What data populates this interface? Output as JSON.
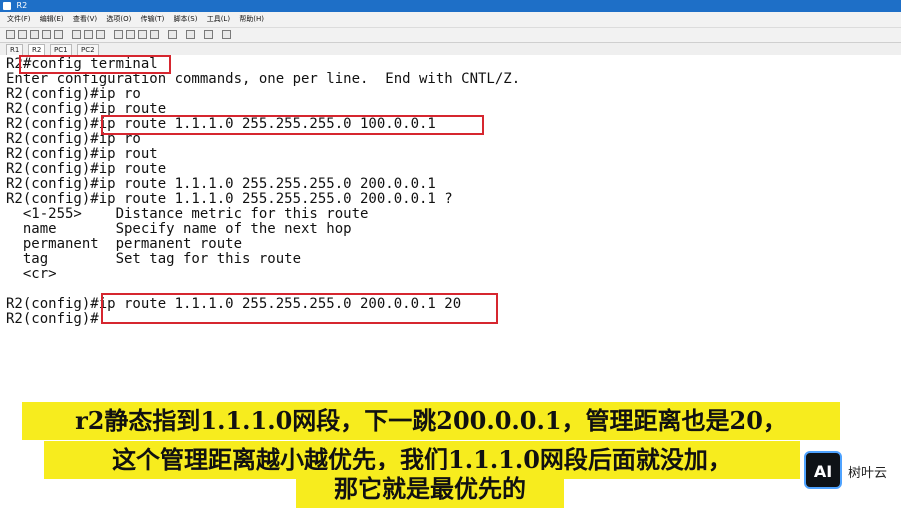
{
  "window": {
    "title": "R2"
  },
  "menu": [
    "文件(F)",
    "编辑(E)",
    "查看(V)",
    "选项(O)",
    "传输(T)",
    "脚本(S)",
    "工具(L)",
    "帮助(H)"
  ],
  "tabs": [
    "R1",
    "R2",
    "PC1",
    "PC2"
  ],
  "terminal": {
    "lines": [
      "R2#config terminal",
      "Enter configuration commands, one per line.  End with CNTL/Z.",
      "R2(config)#ip ro",
      "R2(config)#ip route",
      "R2(config)#ip route 1.1.1.0 255.255.255.0 100.0.0.1",
      "R2(config)#ip ro",
      "R2(config)#ip rout",
      "R2(config)#ip route",
      "R2(config)#ip route 1.1.1.0 255.255.255.0 200.0.0.1",
      "R2(config)#ip route 1.1.1.0 255.255.255.0 200.0.0.1 ?",
      "  <1-255>    Distance metric for this route",
      "  name       Specify name of the next hop",
      "  permanent  permanent route",
      "  tag        Set tag for this route",
      "  <cr>",
      "",
      "R2(config)#ip route 1.1.1.0 255.255.255.0 200.0.0.1 20",
      "R2(config)#"
    ]
  },
  "caption": {
    "line1": "r2静态指到1.1.1.0网段，下一跳200.0.0.1，管理距离也是20，",
    "line2": "这个管理距离越小越优先，我们1.1.1.0网段后面就没加，",
    "line3": "那它就是最优先的"
  },
  "watermark": {
    "logo": "AI",
    "text": "树叶云"
  }
}
